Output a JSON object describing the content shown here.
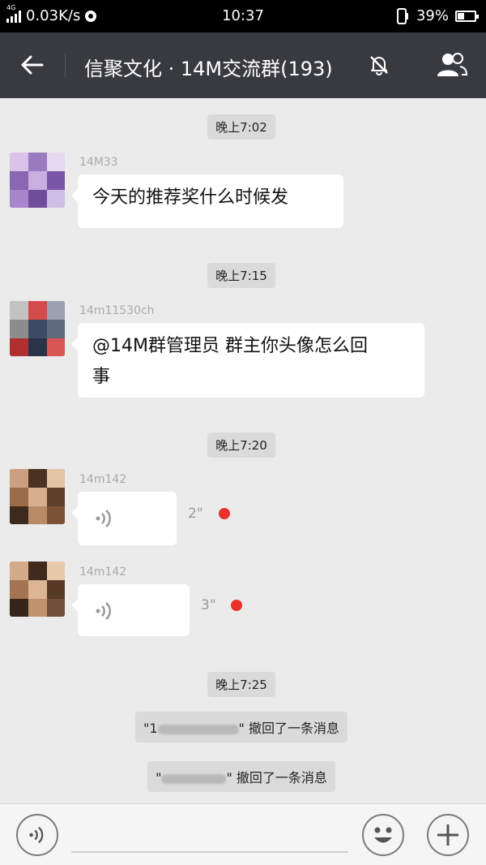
{
  "status_bar": {
    "network_type": "4G",
    "speed": "0.03K/s",
    "time": "10:37",
    "battery": "39%",
    "battery_level": 0.39
  },
  "header": {
    "title": "信聚文化 · 14M交流群(193)",
    "muted": true
  },
  "chat": {
    "items": [
      {
        "type": "time",
        "text": "晚上7:02"
      },
      {
        "type": "text",
        "sender": "14M33",
        "text": "今天的推荐奖什么时候发"
      },
      {
        "type": "time",
        "text": "晚上7:15"
      },
      {
        "type": "text",
        "sender": "14m11530ch",
        "lines": [
          "@14M群管理员  群主你头像怎么回",
          "事"
        ]
      },
      {
        "type": "time",
        "text": "晚上7:20"
      },
      {
        "type": "voice",
        "sender": "14m142",
        "duration": "2\"",
        "unread": true
      },
      {
        "type": "voice",
        "sender": "14m142",
        "duration": "3\"",
        "unread": true
      },
      {
        "type": "time",
        "text": "晚上7:25"
      },
      {
        "type": "system",
        "open_quote": "\"1",
        "close_quote": "\"",
        "text": "撤回了一条消息"
      },
      {
        "type": "system",
        "open_quote": "\"",
        "close_quote": "\"",
        "text": "撤回了一条消息"
      }
    ]
  },
  "bottom_bar": {
    "voice_button_icon": "voice-icon",
    "emoji_button_icon": "emoji-icon",
    "plus_button_icon": "plus-icon",
    "input_value": ""
  },
  "colors": {
    "header_bg": "#393a3f",
    "chat_bg": "#ebebeb",
    "unread_dot": "#e8312a"
  }
}
